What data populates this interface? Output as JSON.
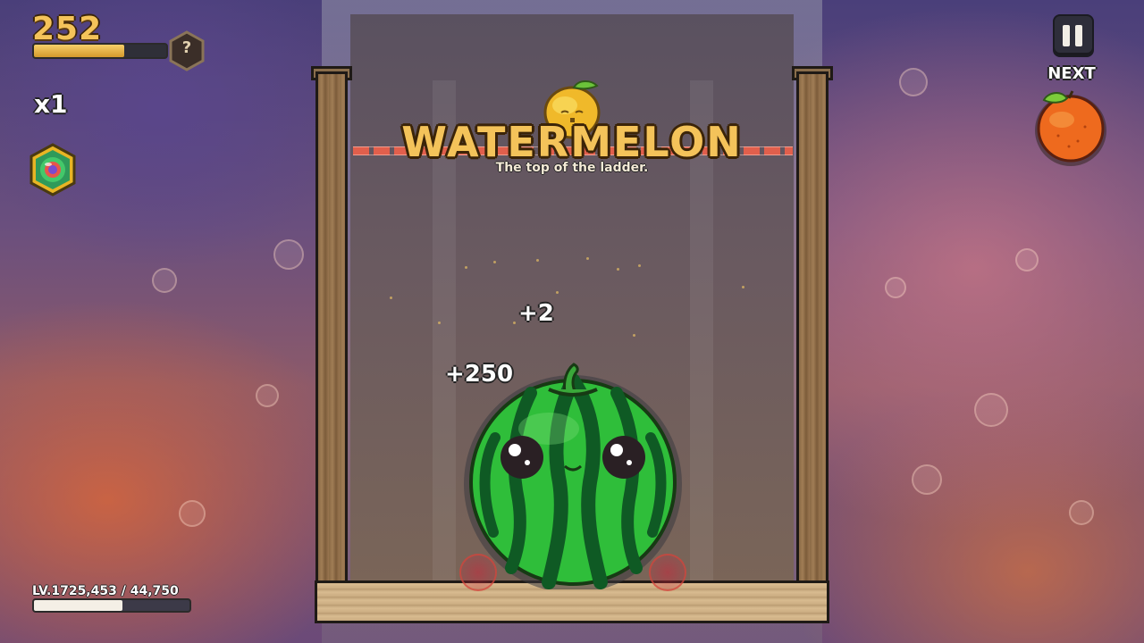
{
  "hud": {
    "score": "252",
    "score_progress": 0.68,
    "hint_symbol": "?",
    "multiplier": "x1",
    "power_icon": "rainbow-gem-icon",
    "pause_icon": "pause-icon"
  },
  "next": {
    "label": "NEXT",
    "fruit": "orange"
  },
  "level": {
    "text": "LV.17",
    "progress_text": "25,453 / 44,750",
    "progress": 0.57
  },
  "banner": {
    "title": "WATERMELON",
    "subtitle": "The top of the ladder."
  },
  "popups": {
    "small": "+2",
    "big": "+250"
  },
  "board": {
    "held_fruit": "lemon",
    "merged_fruit": "watermelon"
  },
  "colors": {
    "score_gold": "#f4c35a",
    "danger_line": "#e15f4c",
    "watermelon_green": "#2fbe3a"
  }
}
